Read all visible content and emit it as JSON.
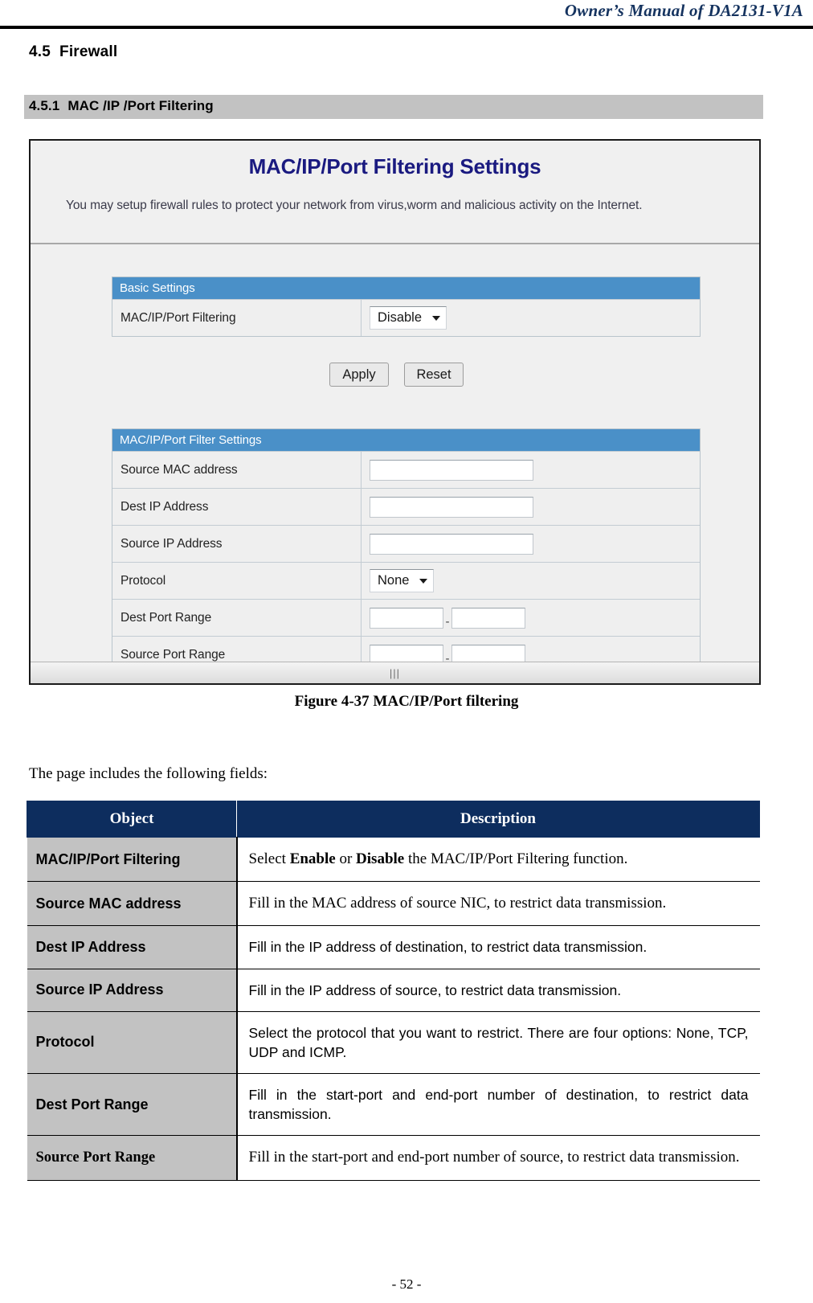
{
  "header": {
    "manual_title": "Owner’s Manual of DA2131-V1A"
  },
  "headings": {
    "section_number": "4.5",
    "section_title": "Firewall",
    "subsection_number": "4.5.1",
    "subsection_title": "MAC /IP /Port Filtering"
  },
  "figure": {
    "screenshot": {
      "title": "MAC/IP/Port Filtering Settings",
      "description": "You may setup firewall rules to protect your network from virus,worm and malicious activity on the Internet.",
      "basic_settings": {
        "header": "Basic Settings",
        "rows": [
          {
            "label": "MAC/IP/Port Filtering",
            "value": "Disable",
            "control": "select"
          }
        ],
        "buttons": {
          "apply": "Apply",
          "reset": "Reset"
        }
      },
      "filter_settings": {
        "header": "MAC/IP/Port Filter Settings",
        "rows": [
          {
            "label": "Source MAC address",
            "value": "",
            "control": "text"
          },
          {
            "label": "Dest IP Address",
            "value": "",
            "control": "text"
          },
          {
            "label": "Source IP Address",
            "value": "",
            "control": "text"
          },
          {
            "label": "Protocol",
            "value": "None",
            "control": "select"
          },
          {
            "label": "Dest Port Range",
            "value": "",
            "value2": "",
            "control": "range"
          },
          {
            "label": "Source Port Range",
            "value": "",
            "value2": "",
            "control": "range"
          }
        ]
      },
      "scroll_grip": "|||"
    },
    "caption": "Figure 4-37 MAC/IP/Port filtering"
  },
  "intro_text": "The page includes the following fields:",
  "field_table": {
    "columns": [
      "Object",
      "Description"
    ],
    "rows": [
      {
        "object": "MAC/IP/Port Filtering",
        "object_font": "sans",
        "description_html": "Select <b>Enable</b> or <b>Disable</b> the MAC/IP/Port Filtering function.",
        "description_font": "serif",
        "justify": false
      },
      {
        "object": "Source MAC address",
        "object_font": "sans",
        "description_html": "Fill in the MAC address of source NIC, to restrict data transmission.",
        "description_font": "serif",
        "justify": false
      },
      {
        "object": "Dest IP Address",
        "object_font": "sans",
        "description_html": "Fill in the IP address of destination, to restrict data transmission.",
        "description_font": "sans",
        "justify": false
      },
      {
        "object": "Source IP Address",
        "object_font": "sans",
        "description_html": "Fill in the IP address of source, to restrict data transmission.",
        "description_font": "sans",
        "justify": false
      },
      {
        "object": "Protocol",
        "object_font": "sans",
        "description_html": "Select the protocol that you want to restrict. There are four options: None, TCP, UDP and ICMP.",
        "description_font": "sans",
        "justify": true
      },
      {
        "object": "Dest Port Range",
        "object_font": "sans",
        "description_html": "Fill in the start-port and end-port number of destination, to restrict data transmission.",
        "description_font": "sans",
        "justify": true
      },
      {
        "object": "Source Port Range",
        "object_font": "serif",
        "description_html": "Fill in the start-port and end-port number of source, to restrict data transmission.",
        "description_font": "serif",
        "justify": false
      }
    ]
  },
  "footer": {
    "page_number": "- 52 -"
  },
  "colors": {
    "header_navy": "#15335f",
    "band_gray": "#c2c2c2",
    "panel_blue": "#4a90c8",
    "table_header_navy": "#0d2d5e",
    "shot_title_blue": "#1a1a80"
  }
}
